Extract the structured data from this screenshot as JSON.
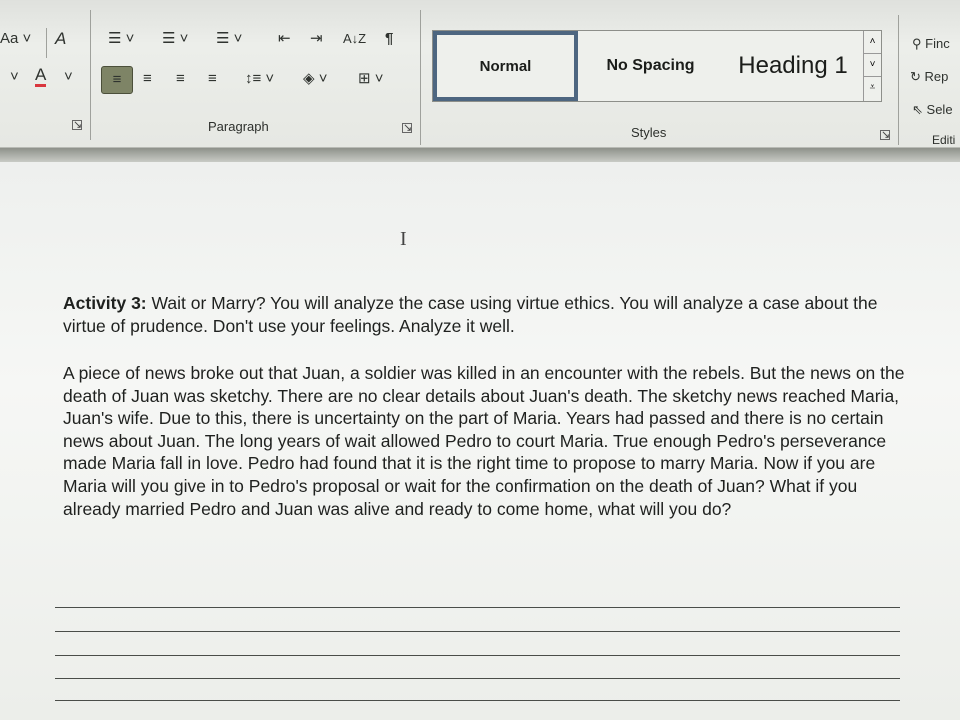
{
  "ribbon": {
    "font_group": {
      "change_case_icon": "Aa",
      "clear_format_icon": "A",
      "font_color_icon": "A",
      "font_color": "#d9363e"
    },
    "paragraph_group": {
      "label": "Paragraph",
      "sort_icon": "A↓Z",
      "pilcrow_icon": "¶"
    },
    "styles_group": {
      "label": "Styles",
      "items": [
        {
          "label": "Normal",
          "selected": true
        },
        {
          "label": "No Spacing"
        },
        {
          "label": "Heading 1"
        }
      ]
    },
    "editing_group": {
      "label": "Editi",
      "find": "Finc",
      "replace": "Rep",
      "select": "Sele"
    }
  },
  "document": {
    "activity_label": "Activity 3:",
    "activity_text": " Wait or Marry? You will analyze the case using virtue ethics. You will analyze a case about the virtue of prudence. Don't use your feelings. Analyze it well.",
    "story": "A piece of news broke out that Juan, a soldier was killed in an encounter with the rebels. But the news on the death of Juan was sketchy. There are no clear details about Juan's death. The sketchy news reached Maria, Juan's wife. Due to this, there is uncertainty on the part of Maria. Years had passed and there is no certain news about Juan. The long years of wait allowed Pedro to court Maria. True enough Pedro's perseverance made Maria fall in love. Pedro had found that it is the right time to propose to marry Maria. Now if you are Maria will you give in to Pedro's proposal or wait for the confirmation on the death of Juan? What if you already married Pedro and Juan was alive and ready to come home, what will you do?",
    "answer_lines": 5
  }
}
